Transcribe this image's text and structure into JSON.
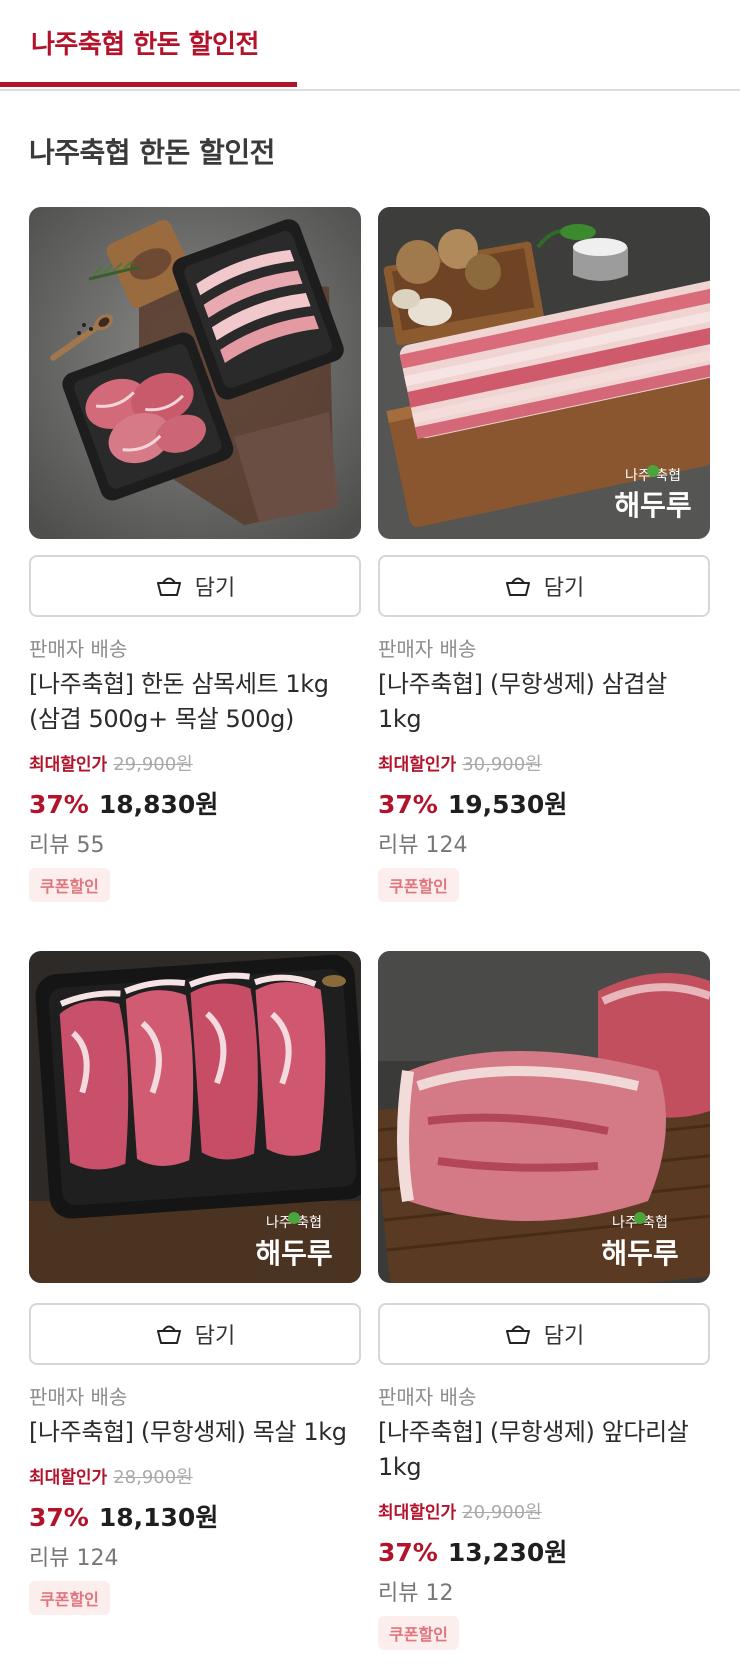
{
  "tabs": [
    {
      "label": "나주축협 한돈 할인전",
      "active": true
    }
  ],
  "section_title": "나주축협 한돈 할인전",
  "colors": {
    "accent": "#b3122b",
    "coupon_text": "#e0757d",
    "coupon_bg": "#fdeeee"
  },
  "products": [
    {
      "image_icon": "pork-samgyeop-moksal-set-photo",
      "cart_label": "담기",
      "seller": "판매자 배송",
      "name": "[나주축협] 한돈 삼목세트 1kg (삼겹 500g+ 목살 500g)",
      "max_discount_label": "최대할인가",
      "original_price": "29,900원",
      "discount": "37%",
      "price": "18,830원",
      "review": "리뷰 55",
      "coupon": "쿠폰할인"
    },
    {
      "image_icon": "pork-belly-photo",
      "brand_small": "나주 축협",
      "brand_large": "해두루",
      "cart_label": "담기",
      "seller": "판매자 배송",
      "name": "[나주축협] (무항생제) 삼겹살 1kg",
      "max_discount_label": "최대할인가",
      "original_price": "30,900원",
      "discount": "37%",
      "price": "19,530원",
      "review": "리뷰 124",
      "coupon": "쿠폰할인"
    },
    {
      "image_icon": "pork-neck-photo",
      "brand_small": "나주 축협",
      "brand_large": "해두루",
      "cart_label": "담기",
      "seller": "판매자 배송",
      "name": "[나주축협] (무항생제) 목살 1kg",
      "max_discount_label": "최대할인가",
      "original_price": "28,900원",
      "discount": "37%",
      "price": "18,130원",
      "review": "리뷰 124",
      "coupon": "쿠폰할인"
    },
    {
      "image_icon": "pork-shoulder-photo",
      "brand_small": "나주 축협",
      "brand_large": "해두루",
      "cart_label": "담기",
      "seller": "판매자 배송",
      "name": "[나주축협] (무항생제) 앞다리살 1kg",
      "max_discount_label": "최대할인가",
      "original_price": "20,900원",
      "discount": "37%",
      "price": "13,230원",
      "review": "리뷰 12",
      "coupon": "쿠폰할인"
    }
  ]
}
